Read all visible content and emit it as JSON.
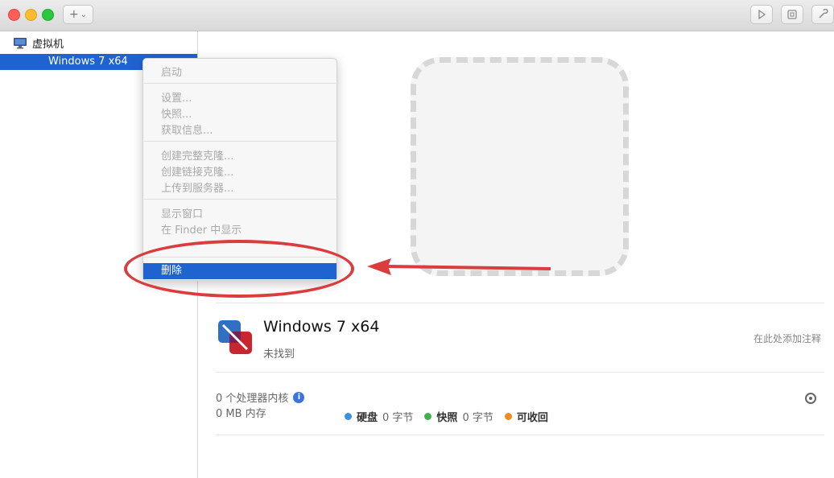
{
  "toolbar": {
    "add_glyph": "+",
    "add_chevron": "⌄",
    "right_icons": [
      "play-icon",
      "snapshot-icon",
      "wrench-icon"
    ]
  },
  "sidebar": {
    "group_label": "虚拟机",
    "items": [
      {
        "label": "Windows 7 x64",
        "selected": true
      }
    ]
  },
  "context_menu": {
    "items": [
      {
        "label": "启动"
      },
      {
        "label": "设置..."
      },
      {
        "label": "快照..."
      },
      {
        "label": "获取信息..."
      },
      {
        "label": "创建完整克隆..."
      },
      {
        "label": "创建链接克隆..."
      },
      {
        "label": "上传到服务器..."
      },
      {
        "label": "显示窗口"
      },
      {
        "label": "在 Finder 中显示"
      },
      {
        "label": "删除",
        "highlighted": true
      }
    ]
  },
  "annotation": {
    "color": "#d93d3d"
  },
  "vm": {
    "name": "Windows 7 x64",
    "status": "未找到",
    "note_placeholder": "在此处添加注释",
    "cores_label": "0 个处理器内核",
    "memory_label": "0 MB 内存",
    "disk": {
      "label": "硬盘",
      "value": "0 字节",
      "color": "#3f8fe0"
    },
    "snapshot": {
      "label": "快照",
      "value": "0 字节",
      "color": "#3fb24a"
    },
    "reclaimable": {
      "label": "可收回",
      "color": "#f08a24"
    }
  }
}
